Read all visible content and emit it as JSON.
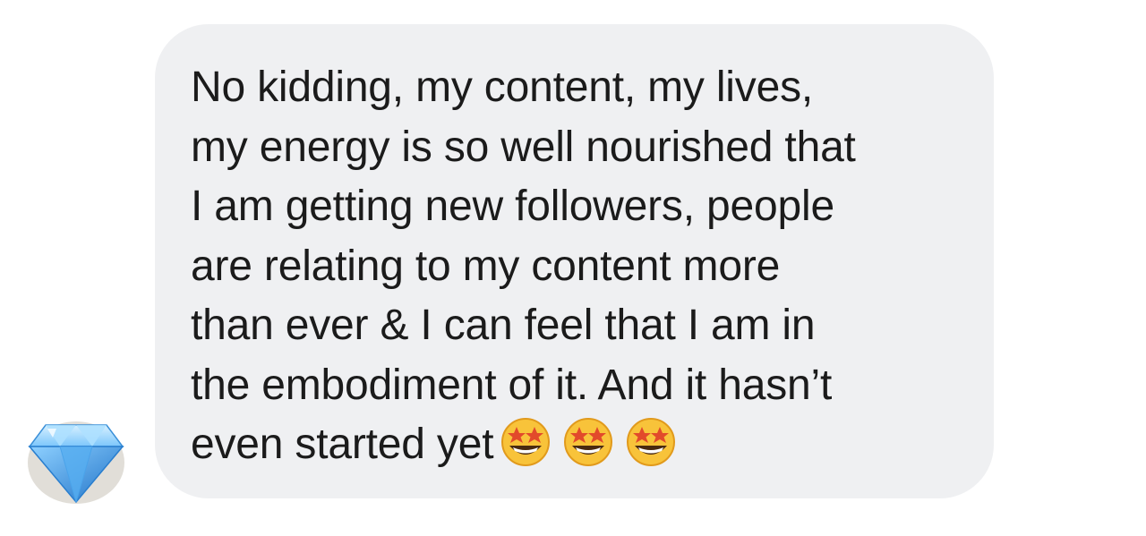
{
  "avatar": {
    "icon": "gem-icon",
    "colors": {
      "light": "#bfe6ff",
      "mid": "#5ab4f4",
      "dark": "#1f72c7"
    }
  },
  "message": {
    "lines": [
      "No kidding, my content, my lives,",
      "my energy is so well nourished that",
      "I am getting new followers, people",
      "are relating to my content more",
      "than ever & I can feel that I am in",
      "the embodiment of it. And it hasn’t",
      "even started yet"
    ],
    "emojis": [
      "star-struck-icon",
      "star-struck-icon",
      "star-struck-icon"
    ],
    "bubble_color": "#eff0f2",
    "text_color": "#1b1b1b"
  }
}
